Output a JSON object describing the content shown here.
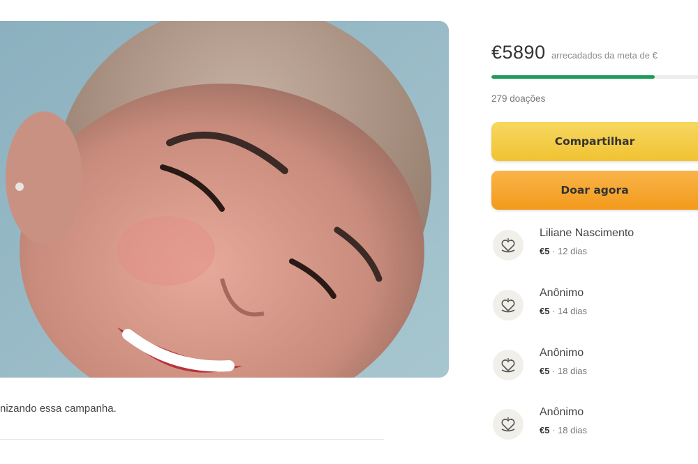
{
  "campaign": {
    "photo_alt": "campaign-photo",
    "caption": "nizando essa campanha."
  },
  "summary": {
    "amount": "€5890",
    "goal_text": "arrecadados da meta de €",
    "progress_fraction": 0.78,
    "progress_color": "#1d9b58",
    "donations_count": "279 doações"
  },
  "actions": {
    "share_label": "Compartilhar",
    "donate_label": "Doar agora",
    "share_color": "#f1c232",
    "donate_color": "#f39a1c"
  },
  "donors": [
    {
      "name": "Liliane Nascimento",
      "amount": "€5",
      "time": " · 12 dias",
      "icon": "donation-heart-icon"
    },
    {
      "name": "Anônimo",
      "amount": "€5",
      "time": " · 14 dias",
      "icon": "donation-heart-icon"
    },
    {
      "name": "Anônimo",
      "amount": "€5",
      "time": " · 18 dias",
      "icon": "donation-heart-icon"
    },
    {
      "name": "Anônimo",
      "amount": "€5",
      "time": " · 18 dias",
      "icon": "donation-heart-icon"
    }
  ]
}
